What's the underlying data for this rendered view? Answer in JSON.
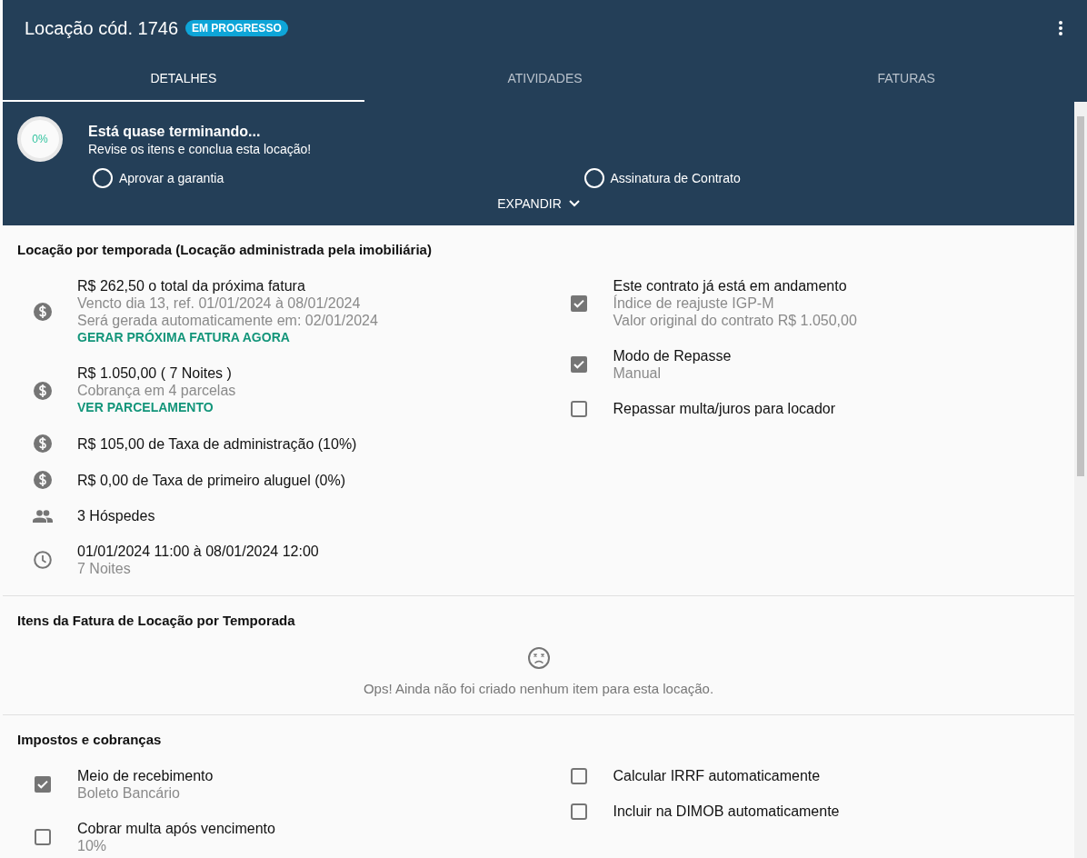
{
  "header": {
    "title": "Locação cód. 1746",
    "status": "EM PROGRESSO"
  },
  "tabs": [
    {
      "label": "DETALHES",
      "selected": true
    },
    {
      "label": "ATIVIDADES",
      "selected": false
    },
    {
      "label": "FATURAS",
      "selected": false
    }
  ],
  "progress": {
    "percent": "0%",
    "title": "Está quase terminando...",
    "subtitle": "Revise os itens e conclua esta locação!",
    "tasks": [
      {
        "label": "Aprovar a garantia",
        "done": false
      },
      {
        "label": "Assinatura de Contrato",
        "done": false
      }
    ],
    "expand": "EXPANDIR"
  },
  "sections": [
    {
      "title": "Locação por temporada (Locação administrada pela imobiliária)",
      "left": [
        {
          "kind": "dollar",
          "main": "R$ 262,50 o total da próxima fatura",
          "details": [
            "Vencto dia 13, ref. 01/01/2024 à 08/01/2024",
            "Será gerada automaticamente em: 02/01/2024"
          ],
          "link": "GERAR PRÓXIMA FATURA AGORA"
        },
        {
          "kind": "dollar",
          "main": "R$ 1.050,00 ( 7 Noites )",
          "details": [
            "Cobrança em 4 parcelas"
          ],
          "link": "VER PARCELAMENTO"
        },
        {
          "kind": "dollar",
          "main": "R$ 105,00 de Taxa de administração (10%)"
        },
        {
          "kind": "dollar",
          "main": "R$ 0,00 de Taxa de primeiro aluguel (0%)"
        },
        {
          "kind": "people",
          "main": "3 Hóspedes"
        },
        {
          "kind": "clock",
          "main": "01/01/2024 11:00 à 08/01/2024 12:00",
          "details": [
            "7 Noites"
          ]
        }
      ],
      "right": [
        {
          "kind": "checkbox",
          "checked": true,
          "main": "Este contrato já está em andamento",
          "details": [
            "Índice de reajuste IGP-M",
            "Valor original do contrato R$ 1.050,00"
          ]
        },
        {
          "kind": "checkbox",
          "checked": true,
          "main": "Modo de Repasse",
          "details": [
            "Manual"
          ]
        },
        {
          "kind": "checkbox",
          "checked": false,
          "main": "Repassar multa/juros para locador"
        }
      ]
    },
    {
      "title": "Itens da Fatura de Locação por Temporada",
      "empty": "Ops! Ainda não foi criado nenhum item para esta locação."
    },
    {
      "title": "Impostos e cobranças",
      "left": [
        {
          "kind": "checkbox",
          "checked": true,
          "main": "Meio de recebimento",
          "details": [
            "Boleto Bancário"
          ]
        },
        {
          "kind": "checkbox",
          "checked": false,
          "main": "Cobrar multa após vencimento",
          "details": [
            "10%"
          ]
        }
      ],
      "right": [
        {
          "kind": "checkbox",
          "checked": false,
          "main": "Calcular IRRF automaticamente"
        },
        {
          "kind": "checkbox",
          "checked": false,
          "main": "Incluir na DIMOB automaticamente"
        }
      ]
    }
  ]
}
